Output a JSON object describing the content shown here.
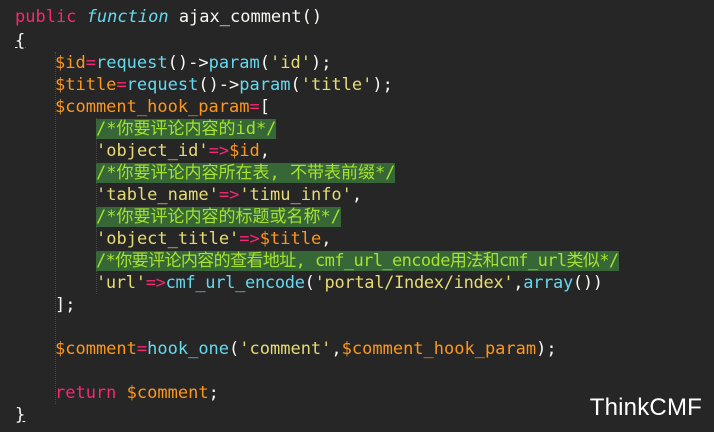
{
  "code": {
    "line1": {
      "kw": "public",
      "kw2": "function",
      "name": "ajax_comment",
      "paren": "()"
    },
    "line2": {
      "brace": "{"
    },
    "line3": {
      "var": "$id",
      "op": "=",
      "fn": "request",
      "p1": "()->",
      "fn2": "param",
      "p2": "(",
      "str": "'id'",
      "p3": ");"
    },
    "line4": {
      "var": "$title",
      "op": "=",
      "fn": "request",
      "p1": "()->",
      "fn2": "param",
      "p2": "(",
      "str": "'title'",
      "p3": ");"
    },
    "line5": {
      "var": "$comment_hook_param",
      "op": "=",
      "p1": "["
    },
    "line6": {
      "comment": "/*你要评论内容的id*/"
    },
    "line7": {
      "str": "'object_id'",
      "op": "=>",
      "var": "$id",
      "p1": ","
    },
    "line8": {
      "comment": "/*你要评论内容所在表, 不带表前缀*/"
    },
    "line9": {
      "str": "'table_name'",
      "op": "=>",
      "str2": "'timu_info'",
      "p1": ","
    },
    "line10": {
      "comment": "/*你要评论内容的标题或名称*/"
    },
    "line11": {
      "str": "'object_title'",
      "op": "=>",
      "var": "$title",
      "p1": ","
    },
    "line12": {
      "comment": "/*你要评论内容的查看地址, cmf_url_encode用法和cmf_url类似*/"
    },
    "line13": {
      "str": "'url'",
      "op": "=>",
      "fn": "cmf_url_encode",
      "p1": "(",
      "str2": "'portal/Index/index'",
      "p2": ",",
      "fn2": "array",
      "p3": "())"
    },
    "line14": {
      "p1": "];"
    },
    "line16": {
      "var": "$comment",
      "op": "=",
      "fn": "hook_one",
      "p1": "(",
      "str": "'comment'",
      "p2": ",",
      "var2": "$comment_hook_param",
      "p3": ");"
    },
    "line18": {
      "kw": "return",
      "var": "$comment",
      "p1": ";"
    },
    "line19": {
      "brace": "}"
    }
  },
  "watermark": "ThinkCMF"
}
